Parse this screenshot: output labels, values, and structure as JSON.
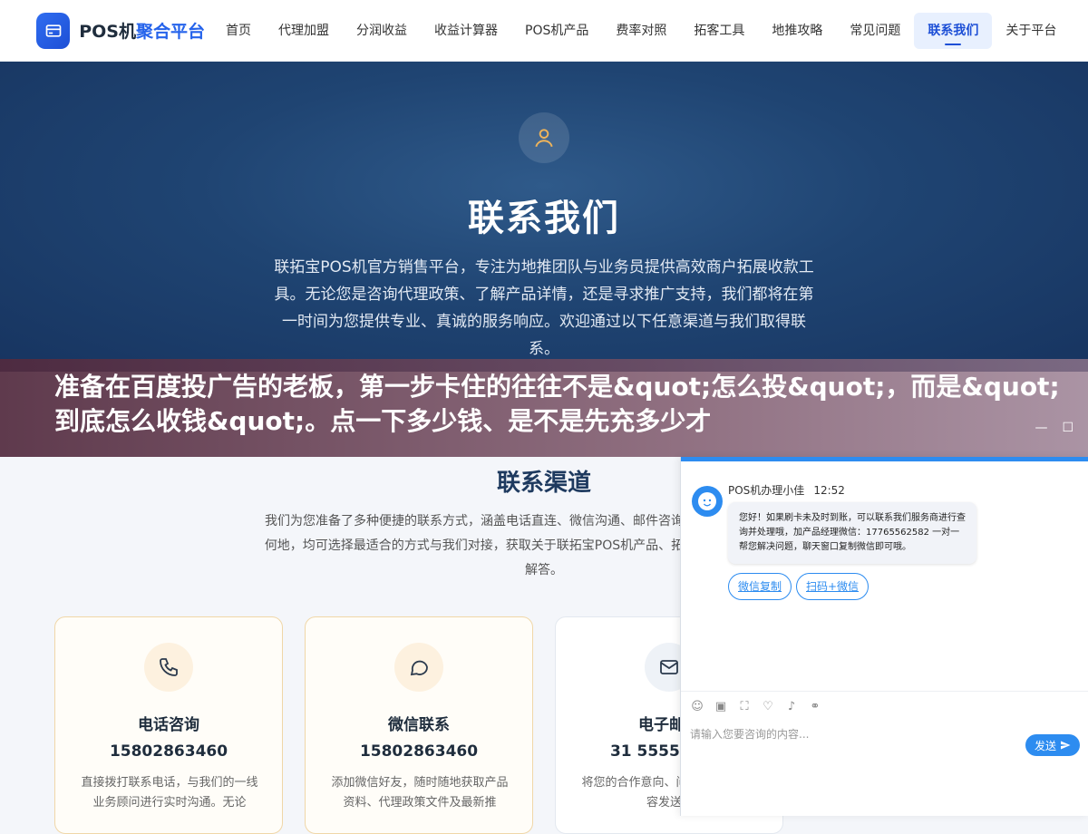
{
  "brand": {
    "name_a": "POS机",
    "name_b": "聚合平台"
  },
  "nav": {
    "items": [
      {
        "label": "首页"
      },
      {
        "label": "代理加盟"
      },
      {
        "label": "分润收益"
      },
      {
        "label": "收益计算器"
      },
      {
        "label": "POS机产品"
      },
      {
        "label": "费率对照"
      },
      {
        "label": "拓客工具"
      },
      {
        "label": "地推攻略"
      },
      {
        "label": "常见问题"
      },
      {
        "label": "联系我们",
        "active": true
      },
      {
        "label": "关于平台"
      }
    ]
  },
  "hero": {
    "icon": "user-icon",
    "title": "联系我们",
    "description": "联拓宝POS机官方销售平台，专注为地推团队与业务员提供高效商户拓展收款工具。无论您是咨询代理政策、了解产品详情，还是寻求推广支持，我们都将在第一时间为您提供专业、真诚的服务响应。欢迎通过以下任意渠道与我们取得联系。"
  },
  "banner": {
    "text": "准备在百度投广告的老板，第一步卡住的往往不是&quot;怎么投&quot;，而是&quot;到底怎么收钱&quot;。点一下多少钱、是不是先充多少才"
  },
  "channels": {
    "title": "联系渠道",
    "description": "我们为您准备了多种便捷的联系方式，涵盖电话直连、微信沟通、邮件咨询等多种途径。无论您身处何地，均可选择最适合的方式与我们对接，获取关于联拓宝POS机产品、拓客工具及分润政策的详细解答。",
    "cards": [
      {
        "icon": "phone-icon",
        "title": "电话咨询",
        "value": "15802863460",
        "desc": "直接拨打联系电话，与我们的一线业务顾问进行实时沟通。无论"
      },
      {
        "icon": "chat-bubble-icon",
        "title": "微信联系",
        "value": "15802863460",
        "desc": "添加微信好友，随时随地获取产品资料、代理政策文件及最新推"
      },
      {
        "icon": "mail-icon",
        "title": "电子邮件",
        "value": "31 555555 35",
        "desc": "将您的合作意向、问题详细咨询内容发送至"
      }
    ]
  },
  "chat": {
    "agent_name": "POS机办理小佳",
    "time": "12:52",
    "message": "您好！如果刷卡未及时到账，可以联系我们服务商进行查询并处理哦，加产品经理微信：17765562582 一对一帮您解决问题，聊天窗口复制微信即可哦。",
    "chips": [
      "微信复制",
      "扫码+微信"
    ],
    "input_placeholder": "请输入您要咨询的内容...",
    "send_label": "发送",
    "accent": "#2d8cf0"
  }
}
